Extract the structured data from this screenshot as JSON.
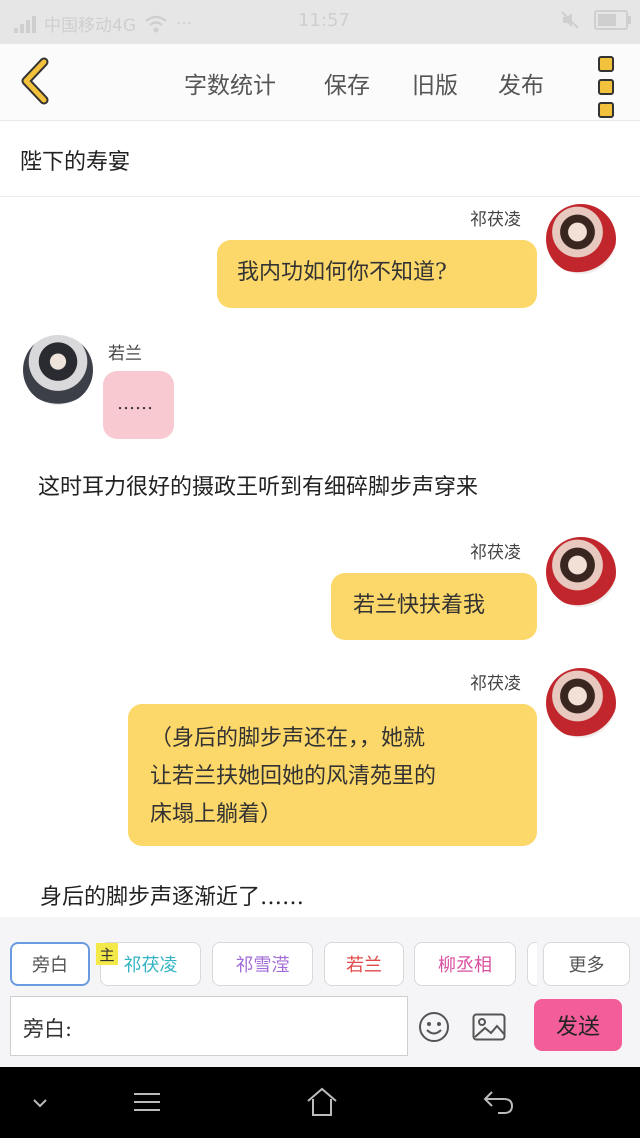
{
  "status_bar": {
    "carrier": "中国移动4G",
    "wifi_icon": "wifi-icon",
    "dots": "···",
    "time": "11:57"
  },
  "toolbar": {
    "word_count": "字数统计",
    "save": "保存",
    "old_version": "旧版",
    "publish": "发布"
  },
  "story": {
    "title": "陛下的寿宴"
  },
  "chat": {
    "messages": [
      {
        "speaker": "祁茯凌",
        "text": "我内功如何你不知道?"
      },
      {
        "speaker": "若兰",
        "text": "……"
      },
      {
        "text": "这时耳力很好的摄政王听到有细碎脚步声穿来"
      },
      {
        "speaker": "祁茯凌",
        "text": "若兰快扶着我"
      },
      {
        "speaker": "祁茯凌",
        "lines": [
          "（身后的脚步声还在，，她就",
          "让若兰扶她回她的风清苑里的",
          "床塌上躺着）"
        ]
      },
      {
        "text": "身后的脚步声逐渐近了……"
      }
    ]
  },
  "composer": {
    "main_tag": "主",
    "chips": [
      "旁白",
      "祁茯凌",
      "祁雪滢",
      "若兰",
      "柳丞相",
      "更多"
    ],
    "chip_colors": [
      "#555555",
      "#33b3c4",
      "#a36cd8",
      "#e04a4a",
      "#d84fa0",
      "#555555"
    ],
    "input_label": "旁白:",
    "send": "发送"
  }
}
